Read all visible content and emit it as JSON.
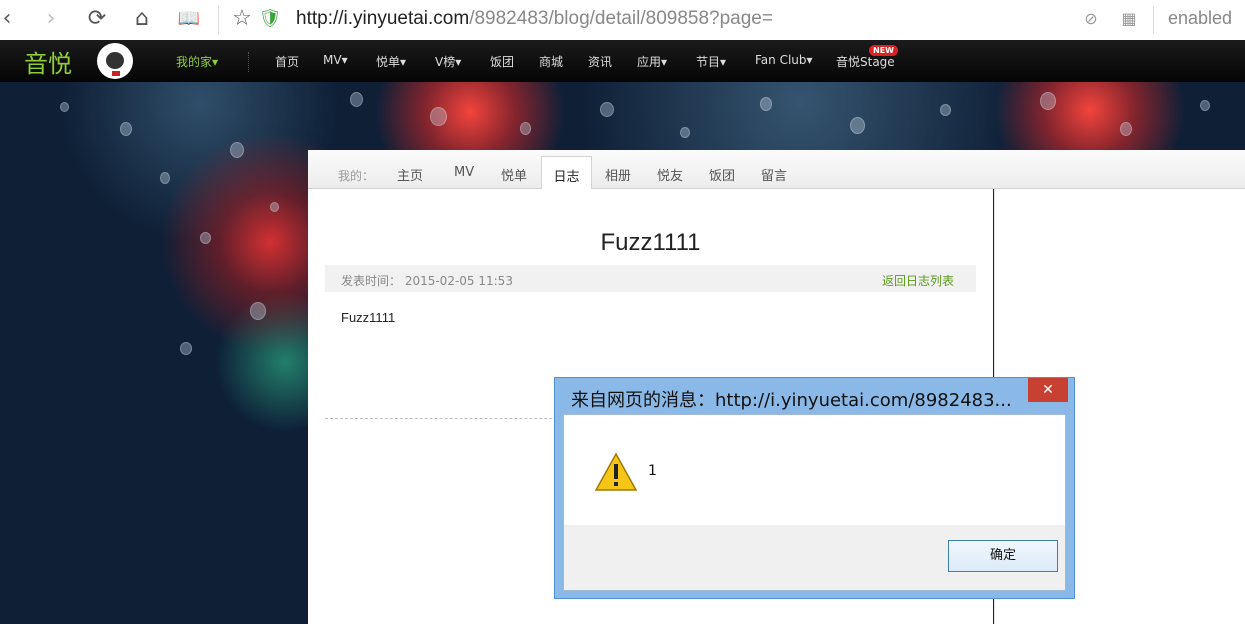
{
  "browser": {
    "url_host": "http://i.yinyuetai.com",
    "url_path": "/8982483/blog/detail/809858?page=",
    "extension_label": "enabled"
  },
  "site": {
    "logo_text": "音悦",
    "nav": {
      "my_home": "我的家▾",
      "items": [
        "首页",
        "MV▾",
        "悦单▾",
        "V榜▾",
        "饭团",
        "商城",
        "资讯",
        "应用▾",
        "节目▾",
        "Fan Club▾",
        "音悦Stage"
      ],
      "new_badge": "NEW"
    }
  },
  "tabs": {
    "label": "我的：",
    "items": [
      "主页",
      "MV",
      "悦单",
      "日志",
      "相册",
      "悦友",
      "饭团",
      "留言"
    ],
    "active": "日志"
  },
  "post": {
    "title": "Fuzz1111",
    "time": "发表时间： 2015-02-05 11:53",
    "back_link": "返回日志列表",
    "body": "Fuzz1111"
  },
  "dialog": {
    "title": "来自网页的消息：http://i.yinyuetai.com/8982483...",
    "close": "✕",
    "message": "1",
    "ok": "确定"
  }
}
